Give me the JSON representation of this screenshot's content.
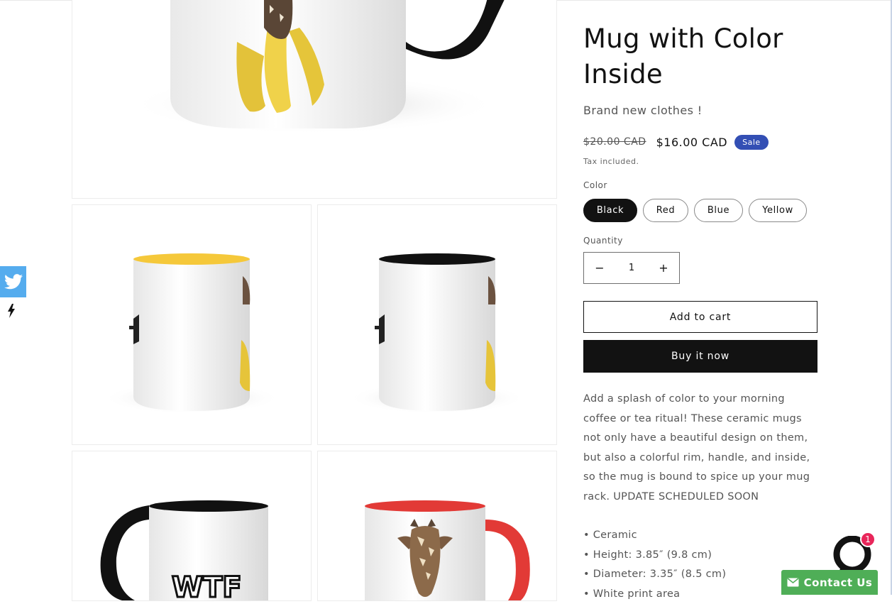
{
  "product": {
    "title": "Mug with Color Inside",
    "subtitle": "Brand new clothes !",
    "price_regular": "$20.00 CAD",
    "price_sale": "$16.00 CAD",
    "sale_badge": "Sale",
    "tax_note": "Tax included.",
    "color_label": "Color",
    "colors": [
      "Black",
      "Red",
      "Blue",
      "Yellow"
    ],
    "selected_color": "Black",
    "quantity_label": "Quantity",
    "quantity": "1",
    "minus": "−",
    "plus": "+",
    "add_to_cart": "Add to cart",
    "buy_now": "Buy it now",
    "description": "Add a splash of color to your morning coffee or tea ritual! These ceramic mugs not only have a beautiful design on them, but also a colorful rim, handle, and inside, so the mug is bound to spice up your mug rack. UPDATE SCHEDULED SOON",
    "specs": [
      "• Ceramic",
      "• Height: 3.85″ (9.8 cm)",
      "• Diameter: 3.35″ (8.5 cm)",
      "• White print area"
    ]
  },
  "gallery": {
    "mug_text": "WTF",
    "mug_colors": {
      "yellow": "#f5c83a",
      "black": "#111111",
      "red": "#e23a36"
    }
  },
  "social": {
    "icon": "twitter-icon",
    "color": "#55acee"
  },
  "chat": {
    "unread": "1",
    "contact_label": "Contact Us",
    "contact_color": "#4fae57",
    "badge_color": "#e8265a"
  },
  "colors": {
    "sale_badge": "#334fb4",
    "primary": "#121212"
  }
}
